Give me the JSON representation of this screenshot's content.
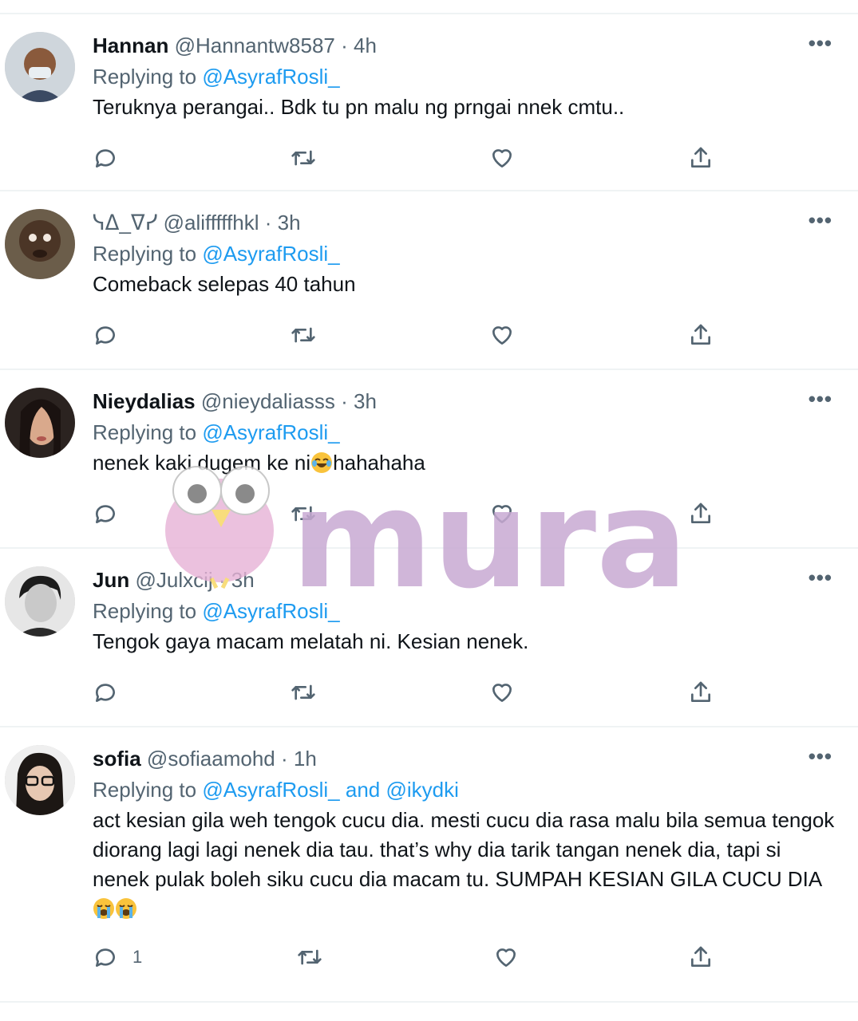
{
  "replying_label": "Replying to",
  "tweets": [
    {
      "name": "Hannan",
      "handle": "@Hannantw8587",
      "dot": "·",
      "time": "4h",
      "replying_to": "@AsyrafRosli_",
      "text": "Teruknya perangai.. Bdk tu pn malu ng prngai nnek cmtu..",
      "reply_count": ""
    },
    {
      "name": "",
      "handle_prefix": "ᓭᐃ_ᐁᓯ",
      "handle": "@alifffffhkl",
      "dot": "·",
      "time": "3h",
      "replying_to": "@AsyrafRosli_",
      "text": "Comeback selepas 40 tahun",
      "reply_count": ""
    },
    {
      "name": "Nieydalias",
      "handle": "@nieydaliasss",
      "dot": "·",
      "time": "3h",
      "replying_to": "@AsyrafRosli_",
      "text_before": "nenek kaki dugem ke ni",
      "text_after": "hahahaha",
      "reply_count": ""
    },
    {
      "name": "Jun",
      "handle": "@Julxcij",
      "dot": "·",
      "time": "3h",
      "replying_to": "@AsyrafRosli_",
      "text": "Tengok gaya macam melatah ni. Kesian nenek.",
      "reply_count": ""
    },
    {
      "name": "sofia",
      "handle": "@sofiaamohd",
      "dot": "·",
      "time": "1h",
      "replying_to": "@AsyrafRosli_",
      "replying_and": "and",
      "replying_to_2": "@ikydki",
      "text": "act kesian gila weh tengok cucu dia. mesti cucu dia rasa malu bila semua tengok diorang lagi lagi nenek dia tau. that’s why dia tarik tangan nenek dia, tapi si nenek pulak boleh siku cucu dia macam tu. SUMPAH KESIAN GILA CUCU DIA",
      "reply_count": "1"
    }
  ],
  "icons": {
    "more": "more-icon",
    "reply": "reply-icon",
    "retweet": "retweet-icon",
    "like": "like-icon",
    "share": "share-icon",
    "emoji_laugh": "face-with-tears-of-joy-emoji",
    "emoji_cry": "loudly-crying-face-emoji"
  },
  "watermark": {
    "text": "murai",
    "color": "#c8a9d2"
  },
  "colors": {
    "link": "#1d9bf0",
    "secondary": "#536471",
    "divider": "#eff3f4"
  }
}
